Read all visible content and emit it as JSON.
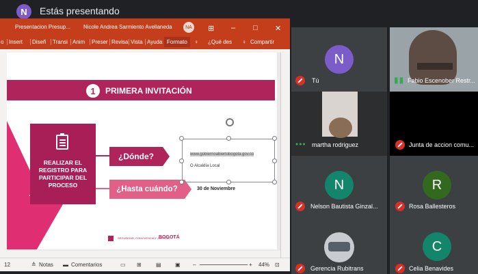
{
  "meet": {
    "presenter_initial": "N",
    "presenting_title": "Estás presentando"
  },
  "ppt": {
    "title_file": "Presentacion Presup...",
    "title_user": "Nicole Andrea Sarmiento Avellaneda",
    "user_initials": "NA",
    "tabs": [
      "o",
      "Insert",
      "Diseñ",
      "Transi",
      "Anim",
      "Preser",
      "Revisa",
      "Vista",
      "Ayuda",
      "Formato",
      "¿Qué des",
      "Compartir"
    ],
    "status": {
      "slide_num": "12",
      "notes": "Notas",
      "comments": "Comentarios",
      "zoom": "44%"
    }
  },
  "slide": {
    "number": "1",
    "heading": "PRIMERA INVITACIÓN",
    "register_text": "REALIZAR EL REGISTRO PARA PARTICIPAR DEL PROCESO",
    "where": "¿Dónde?",
    "until_when": "¿Hasta cuándo?",
    "bullet1": "www.gobiernoabiertobogota.gov.co",
    "bullet2": "O Alcaldía Local",
    "date": "30 de Noviembre",
    "footer_brand": "BOGOTÁ",
    "footer_dept": "SEGURIDAD, CONVIVENCIA Y JUSTICIA"
  },
  "participants": [
    {
      "initial": "N",
      "name": "Tú",
      "color": "#7b5cc9"
    },
    {
      "name": "Fabio Escenober Restr..."
    },
    {
      "name": "martha rodriguez"
    },
    {
      "name": "Junta de accion comu..."
    },
    {
      "initial": "N",
      "name": "Nelson Bautista Ginzal...",
      "color": "#12856a"
    },
    {
      "initial": "R",
      "name": "Rosa Ballesteros",
      "color": "#33691e"
    },
    {
      "name": "Gerencia Rubitrans"
    },
    {
      "initial": "C",
      "name": "Celia Benavides",
      "color": "#12856a"
    }
  ]
}
